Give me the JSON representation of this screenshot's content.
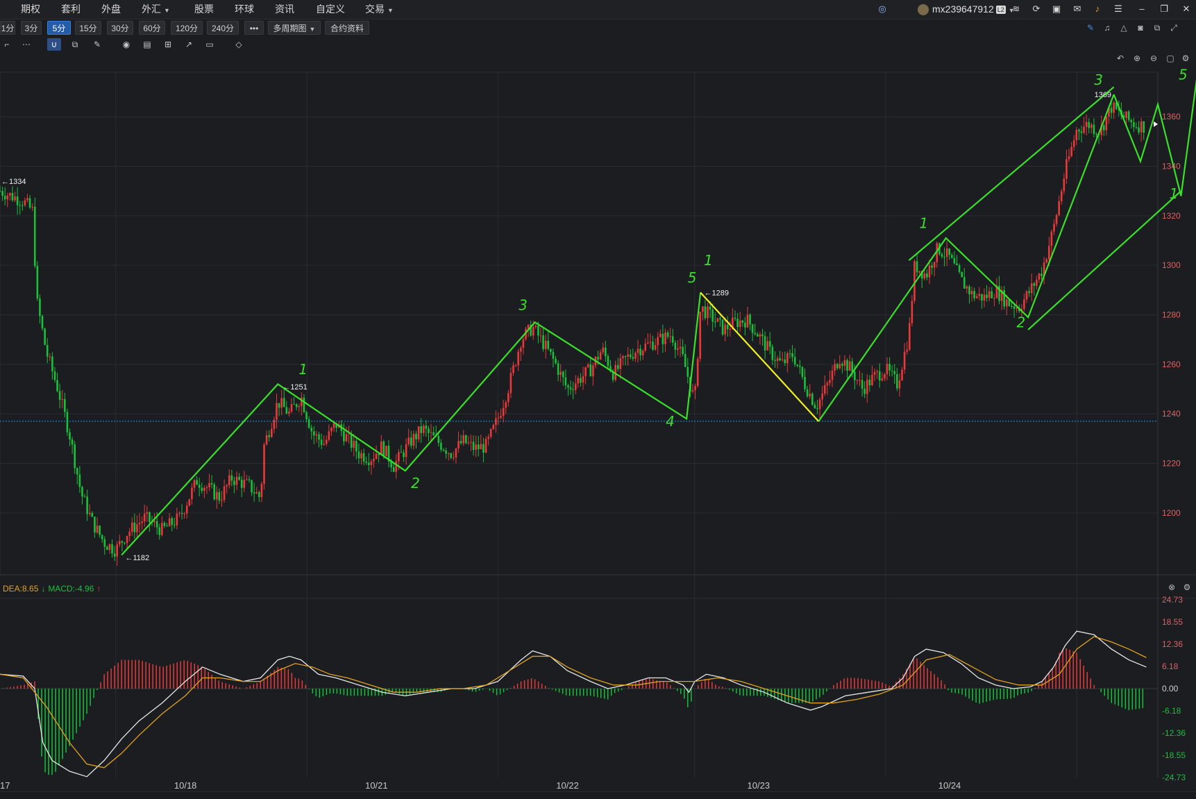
{
  "menu": {
    "items": [
      "期权",
      "套利",
      "外盘",
      "外汇",
      "股票",
      "环球",
      "资讯",
      "自定义",
      "交易"
    ],
    "with_dropdown": [
      false,
      false,
      false,
      true,
      false,
      false,
      false,
      false,
      true
    ]
  },
  "user": {
    "name": "mx239647912",
    "badge": "L2"
  },
  "periods": {
    "buttons": [
      "1分",
      "3分",
      "5分",
      "15分",
      "30分",
      "60分",
      "120分",
      "240分",
      "•••",
      "多周期图",
      "合约资料"
    ],
    "active": "5分"
  },
  "toolbar_icons": [
    "draw-cursor-icon",
    "more-icon",
    "magnet-icon",
    "copy-icon",
    "pen-icon",
    "eye-icon",
    "trash-icon",
    "layers-icon",
    "export-icon",
    "comment-icon",
    "ruler-icon"
  ],
  "colors": {
    "up": "#e83a3a",
    "down": "#19c13a",
    "wave": "#3ae02a",
    "wave_highlight": "#f2f020",
    "dif": "#e8e8e8",
    "dea": "#e1a320",
    "refline": "#2a8fd8"
  },
  "macd": {
    "dea_label": "DEA:8.65",
    "dea_arrow": "↓",
    "macd_label": "MACD:-4.96",
    "macd_arrow": "↑"
  },
  "chart_data": [
    {
      "type": "candlestick",
      "interval": "5分",
      "x_ticks": [
        "17",
        "10/18",
        "10/21",
        "10/22",
        "10/23",
        "10/24"
      ],
      "ylim": [
        1175,
        1378
      ],
      "y_ticks": [
        1200,
        1220,
        1240,
        1260,
        1280,
        1300,
        1320,
        1340,
        1360
      ],
      "reference_line": 1237,
      "price_path": [
        [
          0,
          1330
        ],
        [
          0.02,
          1326
        ],
        [
          0.028,
          1322
        ],
        [
          0.032,
          1285
        ],
        [
          0.04,
          1265
        ],
        [
          0.05,
          1250
        ],
        [
          0.06,
          1232
        ],
        [
          0.07,
          1208
        ],
        [
          0.08,
          1196
        ],
        [
          0.09,
          1188
        ],
        [
          0.1,
          1185
        ],
        [
          0.11,
          1192
        ],
        [
          0.125,
          1198
        ],
        [
          0.14,
          1193
        ],
        [
          0.155,
          1198
        ],
        [
          0.17,
          1213
        ],
        [
          0.18,
          1210
        ],
        [
          0.19,
          1206
        ],
        [
          0.2,
          1214
        ],
        [
          0.215,
          1211
        ],
        [
          0.225,
          1206
        ],
        [
          0.228,
          1227
        ],
        [
          0.24,
          1245
        ],
        [
          0.25,
          1240
        ],
        [
          0.26,
          1247
        ],
        [
          0.27,
          1232
        ],
        [
          0.28,
          1228
        ],
        [
          0.29,
          1236
        ],
        [
          0.3,
          1230
        ],
        [
          0.31,
          1224
        ],
        [
          0.32,
          1222
        ],
        [
          0.33,
          1227
        ],
        [
          0.34,
          1219
        ],
        [
          0.355,
          1229
        ],
        [
          0.365,
          1234
        ],
        [
          0.38,
          1228
        ],
        [
          0.39,
          1224
        ],
        [
          0.4,
          1229
        ],
        [
          0.41,
          1226
        ],
        [
          0.42,
          1227
        ],
        [
          0.43,
          1238
        ],
        [
          0.44,
          1252
        ],
        [
          0.45,
          1270
        ],
        [
          0.46,
          1275
        ],
        [
          0.47,
          1268
        ],
        [
          0.48,
          1260
        ],
        [
          0.49,
          1250
        ],
        [
          0.5,
          1254
        ],
        [
          0.51,
          1258
        ],
        [
          0.52,
          1266
        ],
        [
          0.53,
          1256
        ],
        [
          0.54,
          1262
        ],
        [
          0.55,
          1266
        ],
        [
          0.56,
          1268
        ],
        [
          0.57,
          1270
        ],
        [
          0.58,
          1272
        ],
        [
          0.59,
          1262
        ],
        [
          0.6,
          1245
        ],
        [
          0.605,
          1283
        ],
        [
          0.615,
          1279
        ],
        [
          0.625,
          1274
        ],
        [
          0.635,
          1277
        ],
        [
          0.645,
          1278
        ],
        [
          0.655,
          1272
        ],
        [
          0.665,
          1265
        ],
        [
          0.675,
          1260
        ],
        [
          0.685,
          1264
        ],
        [
          0.695,
          1252
        ],
        [
          0.705,
          1243
        ],
        [
          0.715,
          1252
        ],
        [
          0.725,
          1263
        ],
        [
          0.735,
          1258
        ],
        [
          0.745,
          1250
        ],
        [
          0.755,
          1255
        ],
        [
          0.765,
          1258
        ],
        [
          0.775,
          1252
        ],
        [
          0.785,
          1272
        ],
        [
          0.79,
          1300
        ],
        [
          0.8,
          1296
        ],
        [
          0.81,
          1307
        ],
        [
          0.82,
          1303
        ],
        [
          0.83,
          1294
        ],
        [
          0.84,
          1288
        ],
        [
          0.85,
          1287
        ],
        [
          0.86,
          1290
        ],
        [
          0.87,
          1285
        ],
        [
          0.88,
          1283
        ],
        [
          0.89,
          1290
        ],
        [
          0.9,
          1298
        ],
        [
          0.91,
          1315
        ],
        [
          0.92,
          1338
        ],
        [
          0.93,
          1355
        ],
        [
          0.94,
          1357
        ],
        [
          0.95,
          1354
        ],
        [
          0.96,
          1364
        ],
        [
          0.97,
          1360
        ],
        [
          0.98,
          1357
        ],
        [
          0.99,
          1356
        ]
      ],
      "annotations": [
        {
          "text": "←1334",
          "value": 1334
        },
        {
          "text": "←1182",
          "value": 1182
        },
        {
          "text": "←1251",
          "value": 1251
        },
        {
          "text": "←1289",
          "value": 1289
        },
        {
          "text": "1369",
          "value": 1369
        }
      ],
      "wave_lines": [
        [
          [
            0.105,
            1183
          ],
          [
            0.24,
            1252
          ],
          [
            0.35,
            1217
          ],
          [
            0.462,
            1277
          ],
          [
            0.593,
            1238
          ],
          [
            0.605,
            1289
          ]
        ],
        [
          [
            0.707,
            1237
          ],
          [
            0.817,
            1311
          ],
          [
            0.888,
            1279
          ],
          [
            0.962,
            1369
          ]
        ],
        [
          [
            0.785,
            1302
          ],
          [
            0.962,
            1372
          ]
        ],
        [
          [
            0.888,
            1274
          ],
          [
            1.02,
            1330
          ]
        ],
        [
          [
            0.962,
            1369
          ],
          [
            0.985,
            1342
          ],
          [
            1.0,
            1365
          ],
          [
            1.02,
            1328
          ],
          [
            1.035,
            1380
          ]
        ]
      ],
      "wave_highlight": [
        [
          0.605,
          1289
        ],
        [
          0.707,
          1237
        ]
      ],
      "wave_labels": [
        {
          "text": "1",
          "t": 0.258,
          "y": 1256
        },
        {
          "text": "2",
          "t": 0.355,
          "y": 1210
        },
        {
          "text": "3",
          "t": 0.448,
          "y": 1282
        },
        {
          "text": "4",
          "t": 0.575,
          "y": 1235
        },
        {
          "text": "5",
          "t": 0.594,
          "y": 1293
        },
        {
          "text": "1",
          "t": 0.608,
          "y": 1300
        },
        {
          "text": "1",
          "t": 0.794,
          "y": 1315
        },
        {
          "text": "2",
          "t": 0.878,
          "y": 1275
        },
        {
          "text": "3",
          "t": 0.945,
          "y": 1373
        },
        {
          "text": "1",
          "t": 1.01,
          "y": 1327
        },
        {
          "text": "5",
          "t": 1.018,
          "y": 1375
        }
      ]
    },
    {
      "type": "macd",
      "ylim": [
        -24.73,
        24.73
      ],
      "y_ticks": [
        24.73,
        18.55,
        12.36,
        6.18,
        0.0,
        -6.18,
        -12.36,
        -18.55,
        -24.73
      ],
      "dif": [
        [
          0,
          4
        ],
        [
          0.02,
          3.5
        ],
        [
          0.03,
          0
        ],
        [
          0.037,
          -15
        ],
        [
          0.045,
          -20
        ],
        [
          0.06,
          -23
        ],
        [
          0.075,
          -24.5
        ],
        [
          0.09,
          -20
        ],
        [
          0.105,
          -14
        ],
        [
          0.12,
          -9
        ],
        [
          0.14,
          -4
        ],
        [
          0.16,
          2
        ],
        [
          0.175,
          6
        ],
        [
          0.19,
          4
        ],
        [
          0.21,
          2
        ],
        [
          0.225,
          3
        ],
        [
          0.24,
          8
        ],
        [
          0.25,
          9
        ],
        [
          0.26,
          8
        ],
        [
          0.275,
          4
        ],
        [
          0.29,
          3
        ],
        [
          0.31,
          1
        ],
        [
          0.33,
          -1
        ],
        [
          0.35,
          -2
        ],
        [
          0.37,
          -1
        ],
        [
          0.39,
          0
        ],
        [
          0.41,
          0
        ],
        [
          0.43,
          2
        ],
        [
          0.45,
          8
        ],
        [
          0.46,
          10.5
        ],
        [
          0.475,
          9
        ],
        [
          0.49,
          5
        ],
        [
          0.51,
          2
        ],
        [
          0.525,
          0
        ],
        [
          0.54,
          1
        ],
        [
          0.56,
          3
        ],
        [
          0.575,
          3
        ],
        [
          0.59,
          1
        ],
        [
          0.595,
          -1
        ],
        [
          0.6,
          2
        ],
        [
          0.61,
          4
        ],
        [
          0.625,
          3
        ],
        [
          0.64,
          1
        ],
        [
          0.66,
          -1
        ],
        [
          0.68,
          -4
        ],
        [
          0.7,
          -6
        ],
        [
          0.71,
          -5
        ],
        [
          0.73,
          -2
        ],
        [
          0.75,
          -1
        ],
        [
          0.77,
          0
        ],
        [
          0.78,
          3
        ],
        [
          0.79,
          9
        ],
        [
          0.8,
          11
        ],
        [
          0.815,
          10
        ],
        [
          0.83,
          7
        ],
        [
          0.845,
          3
        ],
        [
          0.86,
          1
        ],
        [
          0.875,
          0
        ],
        [
          0.89,
          0.5
        ],
        [
          0.9,
          2
        ],
        [
          0.91,
          6
        ],
        [
          0.92,
          12
        ],
        [
          0.93,
          16
        ],
        [
          0.945,
          15
        ],
        [
          0.96,
          11
        ],
        [
          0.975,
          8
        ],
        [
          0.99,
          6
        ]
      ],
      "dea": [
        [
          0,
          4
        ],
        [
          0.02,
          3
        ],
        [
          0.04,
          -5
        ],
        [
          0.06,
          -15
        ],
        [
          0.075,
          -21
        ],
        [
          0.09,
          -22
        ],
        [
          0.105,
          -18
        ],
        [
          0.12,
          -13
        ],
        [
          0.14,
          -7
        ],
        [
          0.16,
          -2
        ],
        [
          0.175,
          3
        ],
        [
          0.19,
          3
        ],
        [
          0.21,
          2
        ],
        [
          0.225,
          2
        ],
        [
          0.24,
          5
        ],
        [
          0.255,
          7
        ],
        [
          0.27,
          6
        ],
        [
          0.285,
          4
        ],
        [
          0.3,
          3
        ],
        [
          0.32,
          1
        ],
        [
          0.34,
          -1
        ],
        [
          0.36,
          -1
        ],
        [
          0.38,
          0
        ],
        [
          0.4,
          0
        ],
        [
          0.42,
          1
        ],
        [
          0.44,
          5
        ],
        [
          0.46,
          9
        ],
        [
          0.475,
          9
        ],
        [
          0.49,
          6
        ],
        [
          0.51,
          3
        ],
        [
          0.53,
          1
        ],
        [
          0.55,
          1
        ],
        [
          0.57,
          2
        ],
        [
          0.59,
          2
        ],
        [
          0.6,
          2
        ],
        [
          0.62,
          3
        ],
        [
          0.64,
          2
        ],
        [
          0.66,
          0
        ],
        [
          0.68,
          -2
        ],
        [
          0.7,
          -4
        ],
        [
          0.72,
          -4
        ],
        [
          0.74,
          -3
        ],
        [
          0.76,
          -1.5
        ],
        [
          0.78,
          1
        ],
        [
          0.8,
          8
        ],
        [
          0.82,
          9.5
        ],
        [
          0.84,
          6
        ],
        [
          0.86,
          2.5
        ],
        [
          0.88,
          1
        ],
        [
          0.9,
          1
        ],
        [
          0.915,
          4
        ],
        [
          0.93,
          11
        ],
        [
          0.945,
          14.5
        ],
        [
          0.96,
          13
        ],
        [
          0.975,
          11
        ],
        [
          0.99,
          8.65
        ]
      ]
    }
  ]
}
